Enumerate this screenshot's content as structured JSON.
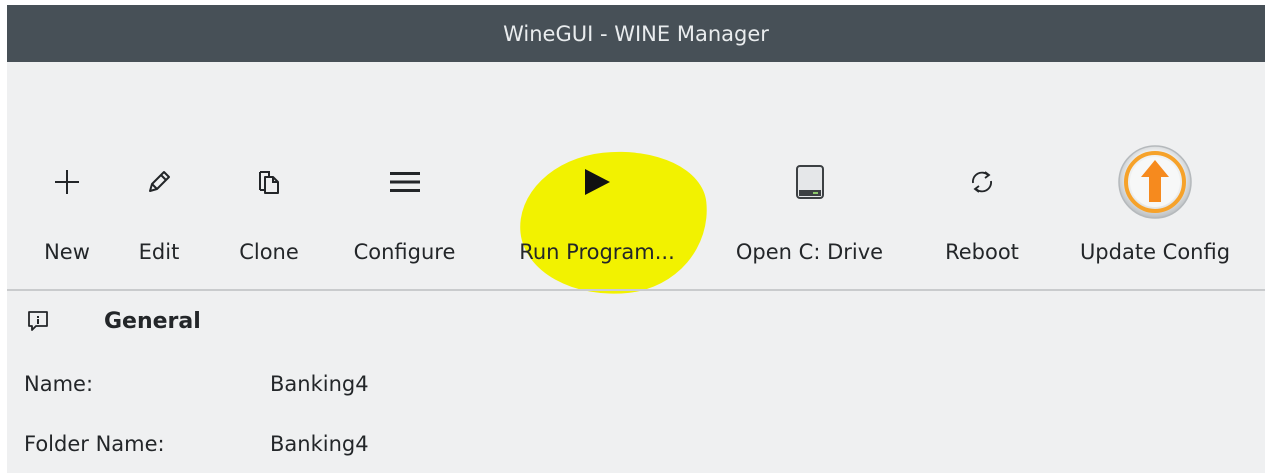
{
  "window": {
    "title": "WineGUI - WINE Manager"
  },
  "toolbar": {
    "items": [
      {
        "label": "New",
        "icon": "plus-icon"
      },
      {
        "label": "Edit",
        "icon": "pencil-icon"
      },
      {
        "label": "Clone",
        "icon": "copy-icon"
      },
      {
        "label": "Configure",
        "icon": "menu-icon"
      },
      {
        "label": "Run Program...",
        "icon": "play-icon"
      },
      {
        "label": "Open C: Drive",
        "icon": "drive-icon"
      },
      {
        "label": "Reboot",
        "icon": "refresh-icon"
      },
      {
        "label": "Update Config",
        "icon": "update-arrow-icon"
      }
    ],
    "highlight_color": "#f2f200"
  },
  "general": {
    "title": "General",
    "icon": "info-icon",
    "rows": [
      {
        "label": "Name:",
        "value": "Banking4"
      },
      {
        "label": "Folder Name:",
        "value": "Banking4"
      }
    ]
  },
  "colors": {
    "titlebar": "#475057",
    "background": "#eff0f1",
    "text": "#232629",
    "update_orange": "#f6a22a"
  }
}
